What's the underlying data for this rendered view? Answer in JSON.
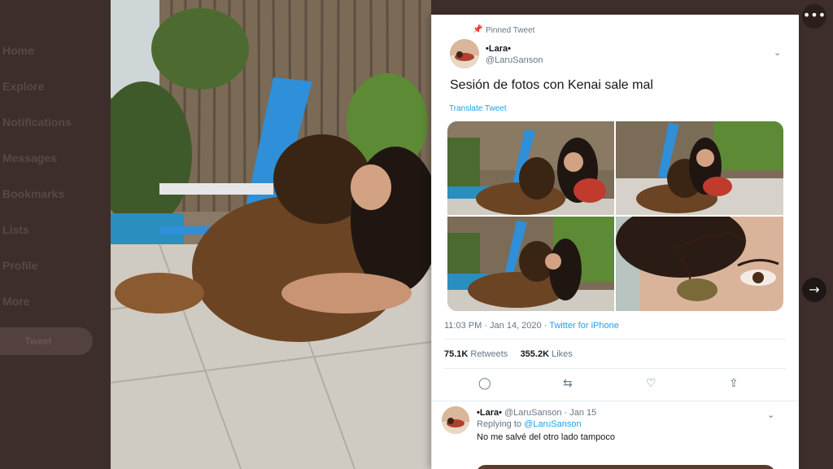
{
  "nav": {
    "items": [
      "Home",
      "Explore",
      "Notifications",
      "Messages",
      "Bookmarks",
      "Lists",
      "Profile",
      "More"
    ],
    "tweet_button": "Tweet"
  },
  "controls": {
    "more_icon": "ellipsis-icon",
    "next_icon": "arrow-right-icon"
  },
  "tweet": {
    "pinned_label": "Pinned Tweet",
    "author_name": "•Lara•",
    "author_handle": "@LaruSanson",
    "text": "Sesión de fotos con Kenai sale mal",
    "translate_label": "Translate Tweet",
    "time": "11:03 PM · Jan 14, 2020 · ",
    "source": "Twitter for iPhone",
    "retweets_count": "75.1K",
    "retweets_label": " Retweets",
    "likes_count": "355.2K",
    "likes_label": " Likes",
    "photos": [
      "photo-1",
      "photo-2",
      "photo-3",
      "photo-4"
    ]
  },
  "reply": {
    "author_name": "•Lara•",
    "handle_date": " @LaruSanson · Jan 15",
    "replying_label": "Replying to ",
    "replying_handle": "@LaruSanson",
    "text": "No me salvé del otro lado tampoco"
  },
  "colors": {
    "backdrop": "#3e2e2b",
    "link": "#1da1f2",
    "secondary_text": "#657786"
  }
}
